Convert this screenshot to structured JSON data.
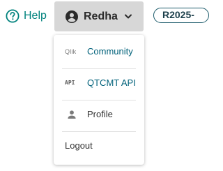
{
  "header": {
    "help_label": "Help",
    "help_icon": "help-circle-icon",
    "user_name": "Redha",
    "user_icon": "account-circle-icon",
    "chevron_icon": "chevron-down-icon",
    "release_label": "R2025-"
  },
  "menu": {
    "items": [
      {
        "label": "Community",
        "icon": "qlik-logo-icon",
        "icon_text": "Qlik"
      },
      {
        "label": "QTCMT API",
        "icon": "api-icon",
        "icon_text": "API"
      },
      {
        "label": "Profile",
        "icon": "person-icon"
      },
      {
        "label": "Logout"
      }
    ]
  },
  "colors": {
    "accent_teal": "#00827d",
    "link_teal": "#00617a",
    "button_bg": "#d7d7d7",
    "release_border": "#1c5b6b"
  }
}
